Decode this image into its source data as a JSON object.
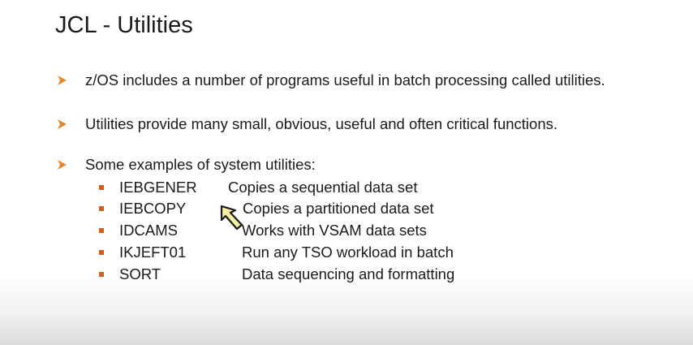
{
  "slide": {
    "title": "JCL - Utilities",
    "bullets": [
      {
        "text": "z/OS includes a number of programs useful in batch processing called utilities."
      },
      {
        "text": "Utilities provide many small, obvious, useful and often critical functions."
      },
      {
        "text": "Some examples of system utilities:"
      }
    ],
    "utilities": [
      {
        "name": "IEBGENER",
        "description": "Copies a sequential data set"
      },
      {
        "name": "IEBCOPY",
        "description": "Copies a partitioned data set"
      },
      {
        "name": "IDCAMS",
        "description": "Works with VSAM data sets"
      },
      {
        "name": "IKJEFT01",
        "description": "Run any TSO workload in batch"
      },
      {
        "name": "SORT",
        "description": "Data sequencing and formatting"
      }
    ]
  },
  "colors": {
    "arrow": "#e0892f",
    "square_bullet": "#d35f1d",
    "cursor_fill": "#f5f0a0"
  },
  "icons": {
    "bullet_arrow": "arrow-bullet-icon",
    "sub_bullet": "square-bullet-icon",
    "pointer": "mouse-cursor-icon"
  }
}
